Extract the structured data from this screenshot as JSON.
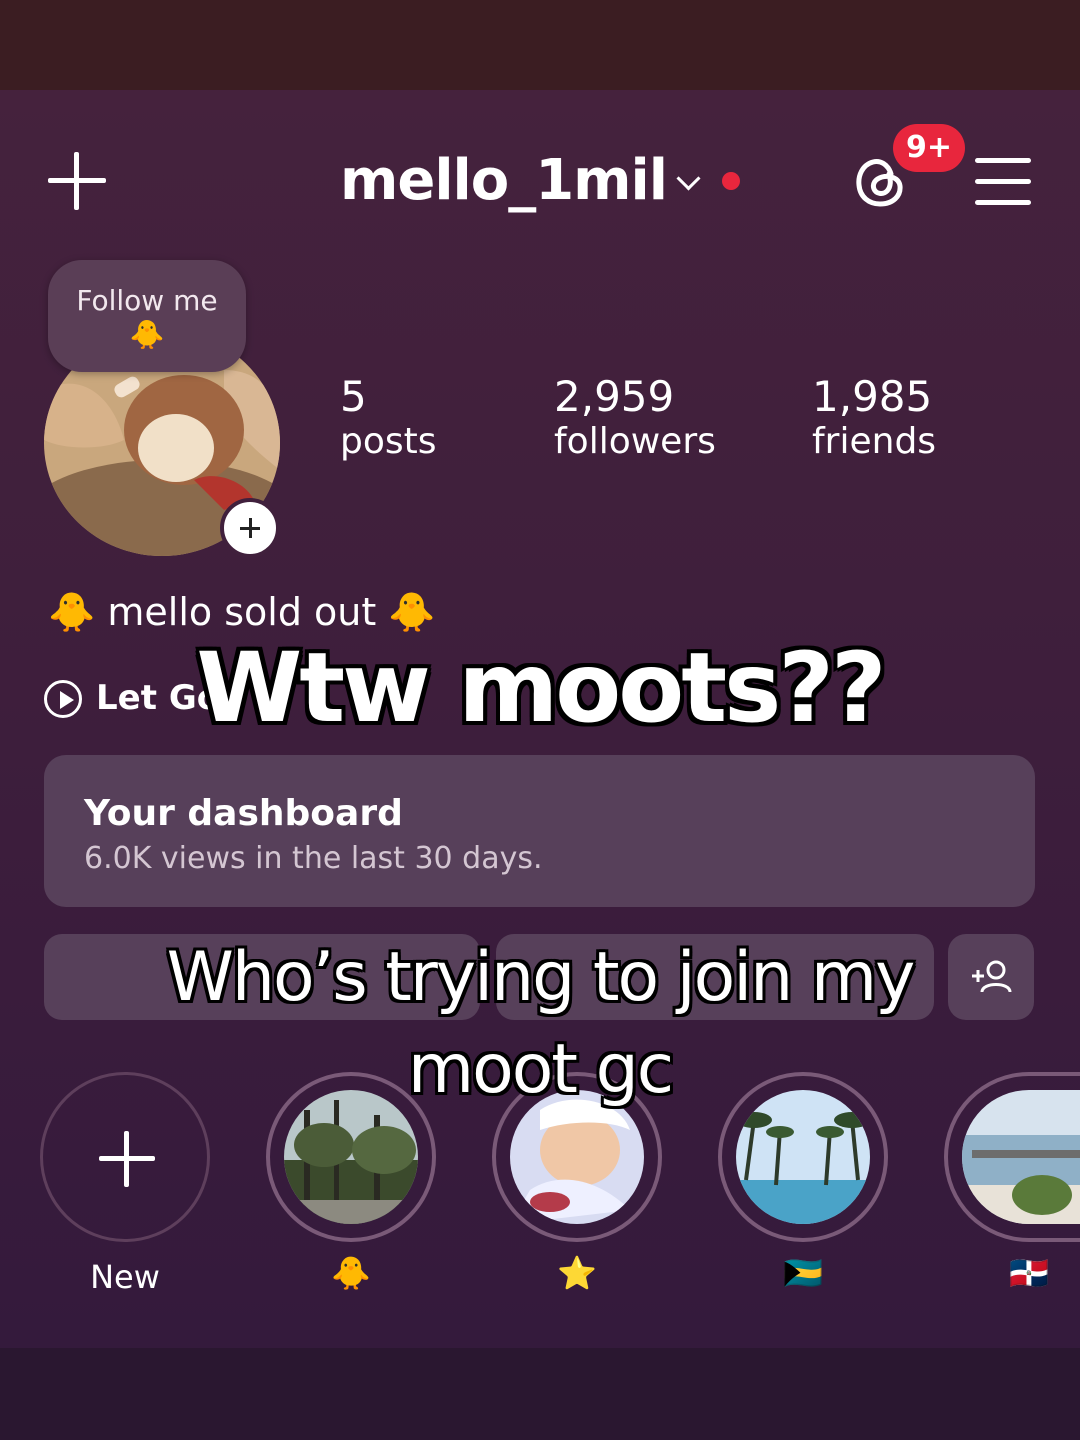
{
  "header": {
    "username": "mello_1mil",
    "notification_badge": "9+",
    "icons": [
      "plus-icon",
      "chevron-down-icon",
      "threads-icon",
      "menu-icon"
    ]
  },
  "profile": {
    "note": {
      "text": "Follow me",
      "emoji": "🐥"
    },
    "stats": [
      {
        "value": "5",
        "label": "posts"
      },
      {
        "value": "2,959",
        "label": "followers"
      },
      {
        "value": "1,985",
        "label": "friends"
      }
    ],
    "bio": "🐥 mello sold out 🐥",
    "music": "Let Go"
  },
  "dashboard": {
    "title": "Your dashboard",
    "subtitle": "6.0K views in the last 30 days."
  },
  "highlights": [
    {
      "label": "New"
    },
    {
      "label": "🐥"
    },
    {
      "label": "⭐"
    },
    {
      "label": "🇧🇸"
    },
    {
      "label": "🇩🇴"
    }
  ],
  "overlay": {
    "headline": "Wtw moots??",
    "caption": "Who’s trying to join my moot gc"
  },
  "colors": {
    "accent_red": "#e8263d",
    "card_bg": "#57405a",
    "screen_bg": "#3f1f3c"
  }
}
